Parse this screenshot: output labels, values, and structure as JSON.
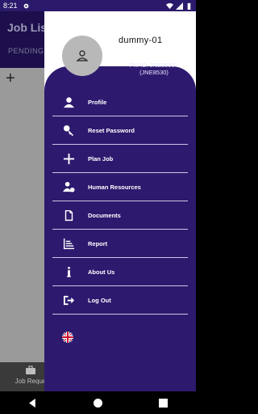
{
  "status_bar": {
    "time": "8:21",
    "icons": [
      "gear-icon",
      "wifi-icon",
      "signal-icon",
      "battery-icon"
    ]
  },
  "background": {
    "title": "Job List",
    "tab": "PENDING",
    "bottom_tab": "Job Reque"
  },
  "drawer": {
    "user_name": "dummy-01",
    "pm_id": "PM ID: JNE8530 - (JNE8530)",
    "menu": [
      {
        "label": "Profile",
        "icon": "person-icon"
      },
      {
        "label": "Reset Password",
        "icon": "key-icon"
      },
      {
        "label": "Plan Job",
        "icon": "plus-icon"
      },
      {
        "label": "Human Resources",
        "icon": "human-resources-icon"
      },
      {
        "label": "Documents",
        "icon": "document-icon"
      },
      {
        "label": "Report",
        "icon": "report-icon"
      },
      {
        "label": "About Us",
        "icon": "info-icon"
      },
      {
        "label": "Log Out",
        "icon": "logout-icon"
      }
    ],
    "language_icon": "uk-flag-icon"
  },
  "colors": {
    "drawer_bg": "#2d1a6e",
    "header_bg": "#1c0f4b",
    "white": "#ffffff"
  }
}
